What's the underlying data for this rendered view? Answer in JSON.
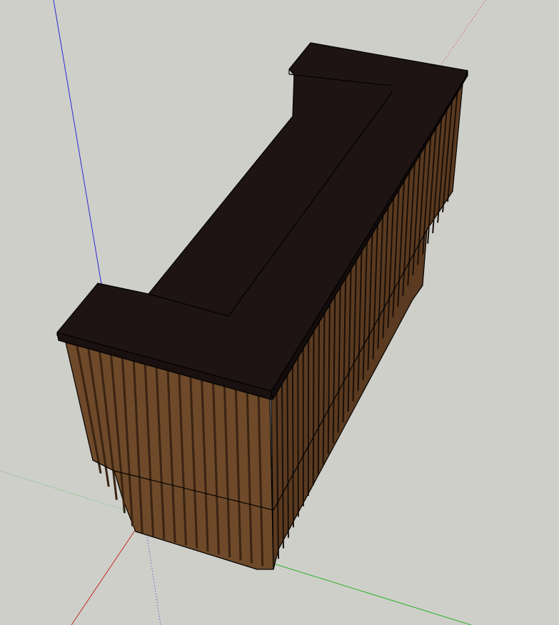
{
  "viewport": {
    "background": "#cfcfca",
    "axes": {
      "red": "#c0302a",
      "green": "#2bb52b",
      "blue": "#2a2ad0"
    },
    "model": {
      "top_color": "#1e1414",
      "wood_color": "#6e4a2a",
      "wood_dark": "#3a2412",
      "slat_count": 18
    }
  }
}
